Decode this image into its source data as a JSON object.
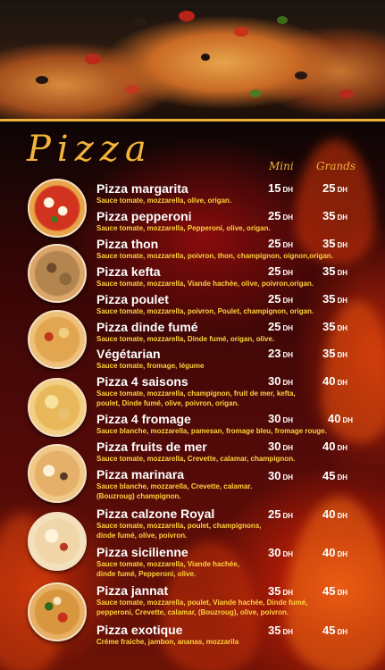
{
  "header": {
    "title": "Pizza",
    "col_mini": "Mini",
    "col_grands": "Grands"
  },
  "currency": "DH",
  "colors": {
    "accent": "#f2b43a",
    "desc": "#ffd23c",
    "name": "#ffffff"
  },
  "items": [
    {
      "name": "Pizza margarita",
      "desc": [
        "Sauce tomate, mozzarella, olive, origan."
      ],
      "mini": "15",
      "grand": "25"
    },
    {
      "name": "Pizza pepperoni",
      "desc": [
        "Sauce tomate, mozzarella, Pepperoni, olive, origan."
      ],
      "mini": "25",
      "grand": "35"
    },
    {
      "name": "Pizza thon",
      "desc": [
        "Sauce tomate, mozzarella, poivron, thon, champignon, oignon,origan."
      ],
      "mini": "25",
      "grand": "35"
    },
    {
      "name": "Pizza kefta",
      "desc": [
        "Sauce tomate, mozzarella, Viande hachée, olive, poivron,origan."
      ],
      "mini": "25",
      "grand": "35"
    },
    {
      "name": "Pizza poulet",
      "desc": [
        "Sauce tomate, mozzarella, poivron, Poulet, champignon, origan."
      ],
      "mini": "25",
      "grand": "35"
    },
    {
      "name": "Pizza dinde fumé",
      "desc": [
        "Sauce tomate, mozzarella, Dinde fumé, origan, olive."
      ],
      "mini": "25",
      "grand": "35"
    },
    {
      "name": "Végétarian",
      "desc": [
        "Sauce tomate, fromage, légume"
      ],
      "mini": "23",
      "grand": "35"
    },
    {
      "name": "Pizza 4 saisons",
      "desc": [
        "Sauce tomate, mozzarella, champignon, fruit de mer, kefta,",
        "poulet, Dinde fumé, olive, poivron, origan."
      ],
      "mini": "30",
      "grand": "40"
    },
    {
      "name": "Pizza 4 fromage",
      "desc": [
        "Sauce blanche, mozzarella, pamesan, fromage bleu, fromage rouge."
      ],
      "mini": "30",
      "grand": "40"
    },
    {
      "name": "Pizza fruits de mer",
      "desc": [
        "Sauce tomate, mozzarella, Crevette, calamar, champignon."
      ],
      "mini": "30",
      "grand": "40"
    },
    {
      "name": "Pizza marinara",
      "desc": [
        "Sauce blanche, mozzarella, Crevette, calamar.",
        "(Bouzroug) champignon."
      ],
      "mini": "30",
      "grand": "45"
    },
    {
      "name": "Pizza calzone Royal",
      "desc": [
        "Sauce tomate, mozzarella, poulet, champignons,",
        "dinde fumé, olive, poivron."
      ],
      "mini": "25",
      "grand": "40"
    },
    {
      "name": "Pizza sicilienne",
      "desc": [
        "Sauce tomate, mozzarella, Viande hachée,",
        "dinde fumé, Pepperoni, olive."
      ],
      "mini": "30",
      "grand": "40"
    },
    {
      "name": "Pizza jannat",
      "desc": [
        "Sauce tomate, mozzarella, poulet, Viande hachée, Dinde fumé,",
        "pepperoni, Crevette, calamar, (Bouzroug), olive, poivron."
      ],
      "mini": "35",
      "grand": "45"
    },
    {
      "name": "Pizza exotique",
      "desc": [
        "Créme fraiche, jambon, ananas, mozzarila"
      ],
      "mini": "35",
      "grand": "45"
    }
  ]
}
